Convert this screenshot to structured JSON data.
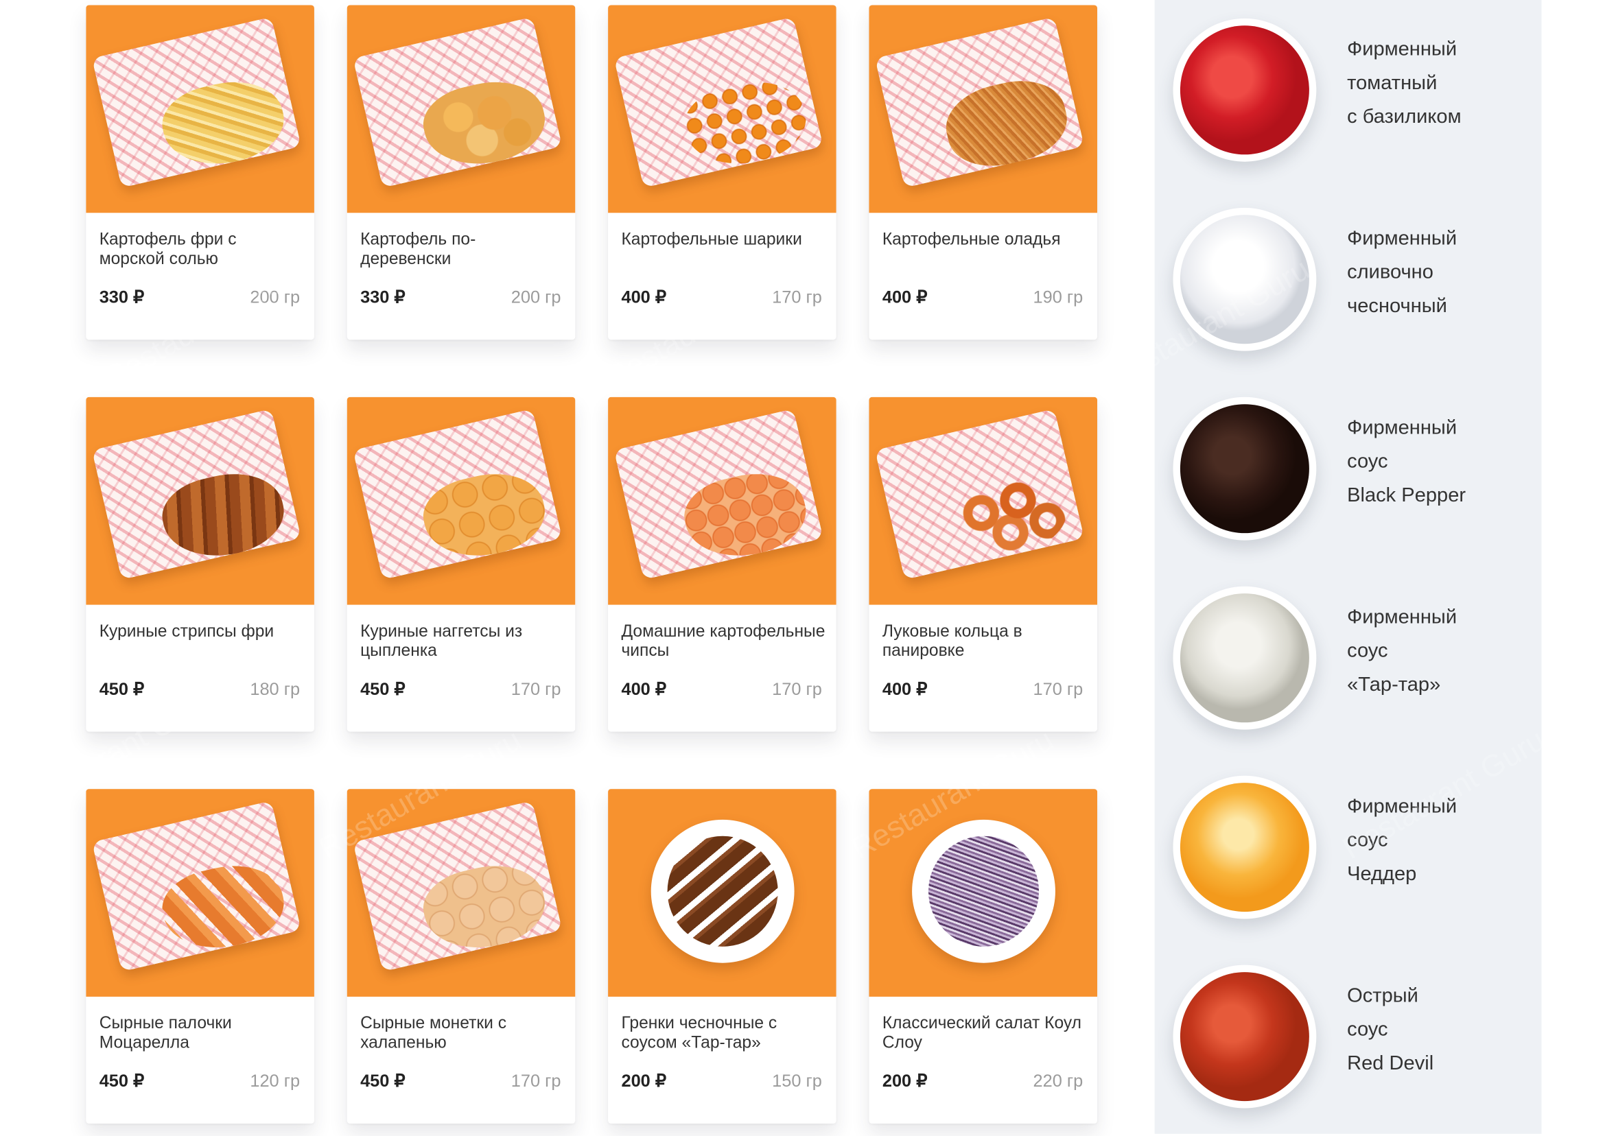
{
  "menu": [
    {
      "name": "Картофель фри с морской солью",
      "price": "330 ₽",
      "weight": "200 гр",
      "food": "fries"
    },
    {
      "name": "Картофель по-деревенски",
      "price": "330 ₽",
      "weight": "200 гр",
      "food": "wedges"
    },
    {
      "name": "Картофельные шарики",
      "price": "400 ₽",
      "weight": "170 гр",
      "food": "balls"
    },
    {
      "name": "Картофельные оладья",
      "price": "400 ₽",
      "weight": "190 гр",
      "food": "hashbrown"
    },
    {
      "name": "Куриные стрипсы фри",
      "price": "450 ₽",
      "weight": "180 гр",
      "food": "strips"
    },
    {
      "name": "Куриные наггетсы из цыпленка",
      "price": "450 ₽",
      "weight": "170 гр",
      "food": "nuggets"
    },
    {
      "name": "Домашние картофельные чипсы",
      "price": "400 ₽",
      "weight": "170 гр",
      "food": "chips"
    },
    {
      "name": "Луковые кольца в панировке",
      "price": "400 ₽",
      "weight": "170 гр",
      "food": "rings"
    },
    {
      "name": "Сырные палочки Моцарелла",
      "price": "450 ₽",
      "weight": "120 гр",
      "food": "sticks"
    },
    {
      "name": "Сырные монетки с халапенью",
      "price": "450 ₽",
      "weight": "170 гр",
      "food": "coins"
    },
    {
      "name": "Гренки чесночные с соусом «Тар-тар»",
      "price": "200 ₽",
      "weight": "150 гр",
      "food": "croutons"
    },
    {
      "name": "Классический салат Коул Слоу",
      "price": "200 ₽",
      "weight": "220 гр",
      "food": "slaw"
    }
  ],
  "sauces": [
    {
      "lines": [
        "Фирменный",
        "томатный",
        "с базиликом"
      ],
      "kind": "tomato"
    },
    {
      "lines": [
        "Фирменный",
        "сливочно",
        "чесночный"
      ],
      "kind": "garlic"
    },
    {
      "lines": [
        "Фирменный",
        "соус",
        "Black Pepper"
      ],
      "kind": "pepper"
    },
    {
      "lines": [
        "Фирменный",
        "соус",
        "«Тар-тар»"
      ],
      "kind": "tartar"
    },
    {
      "lines": [
        "Фирменный",
        "соус",
        "Чеддер"
      ],
      "kind": "cheddar"
    },
    {
      "lines": [
        "Острый",
        "соус",
        "Red Devil"
      ],
      "kind": "devil"
    }
  ],
  "watermark": "Restaurant Guru"
}
